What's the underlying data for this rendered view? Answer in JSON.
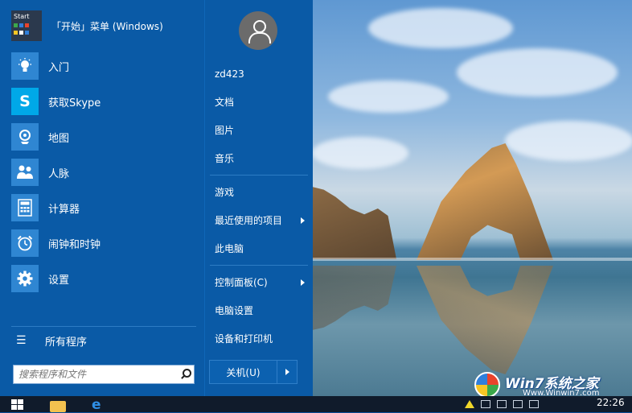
{
  "desktop": {
    "watermark": {
      "title": "Win7系统之家",
      "url": "Www.Winwin7.com"
    }
  },
  "start_menu": {
    "header": {
      "tile_text": "Start",
      "title": "「开始」菜单 (Windows)"
    },
    "apps": [
      {
        "label": "入门",
        "icon": "lightbulb-icon",
        "color": "#2f86d2"
      },
      {
        "label": "获取Skype",
        "icon": "skype-icon",
        "color": "#00a8e8"
      },
      {
        "label": "地图",
        "icon": "map-pin-icon",
        "color": "#2f86d2"
      },
      {
        "label": "人脉",
        "icon": "people-icon",
        "color": "#2f86d2"
      },
      {
        "label": "计算器",
        "icon": "calculator-icon",
        "color": "#2f86d2"
      },
      {
        "label": "闹钟和时钟",
        "icon": "alarm-clock-icon",
        "color": "#2f86d2"
      },
      {
        "label": "设置",
        "icon": "gear-icon",
        "color": "#2f86d2"
      }
    ],
    "all_programs": "所有程序",
    "search": {
      "placeholder": "搜索程序和文件",
      "value": ""
    },
    "user": {
      "name": "zd423"
    },
    "places": {
      "group1": [
        "文档",
        "图片",
        "音乐"
      ],
      "group2": [
        "游戏",
        "最近使用的项目",
        "此电脑"
      ],
      "group3": [
        "控制面板(C)",
        "电脑设置",
        "设备和打印机"
      ]
    },
    "shutdown_label": "关机(U)"
  },
  "taskbar": {
    "time": "22:26"
  },
  "colors": {
    "menu_bg": "#0a5aa6",
    "tile_blue": "#2f86d2",
    "taskbar_bg": "#101b2b"
  }
}
